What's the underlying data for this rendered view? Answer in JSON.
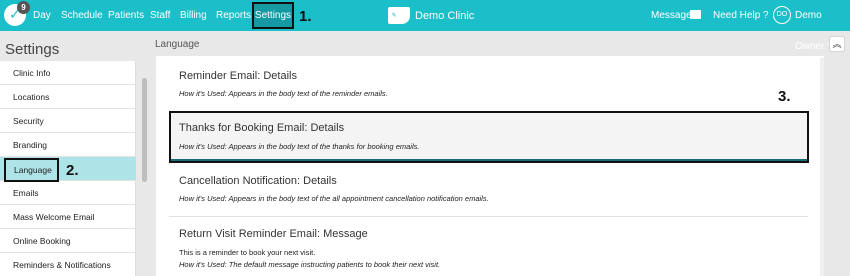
{
  "topbar": {
    "badge_count": "9",
    "nav": [
      "Day",
      "Schedule",
      "Patients",
      "Staff",
      "Billing",
      "Reports"
    ],
    "settings_label": "Settings",
    "brand_name": "Demo Clinic",
    "messages_label": "Messages",
    "help_label": "Need Help ?",
    "avatar_initials": "DO",
    "user_label": "Demo Owner ˅"
  },
  "callouts": [
    "1.",
    "2.",
    "3."
  ],
  "sidebar": {
    "title": "Settings",
    "items": [
      "Clinic Info",
      "Locations",
      "Security",
      "Branding",
      "Language",
      "Emails",
      "Mass Welcome Email",
      "Online Booking",
      "Reminders & Notifications"
    ]
  },
  "main": {
    "title": "Language",
    "collapse_icon": "double-chevron-up",
    "cards": [
      {
        "heading": "Reminder Email: Details",
        "usage": "How it's Used: Appears in the body text of the reminder emails."
      },
      {
        "heading": "Thanks for Booking Email: Details",
        "usage": "How it's Used: Appears in the body text of the thanks for booking emails."
      },
      {
        "heading": "Cancellation Notification: Details",
        "usage": "How it's Used: Appears in the body text of the all appointment cancellation notification emails."
      },
      {
        "heading": "Return Visit Reminder Email: Message",
        "body": "This is a reminder to book your next visit.",
        "usage": "How it's Used: The default message instructing patients to book their next visit."
      }
    ]
  },
  "colors": {
    "accent": "#1bbfc9",
    "active_item": "#aee3e7"
  }
}
